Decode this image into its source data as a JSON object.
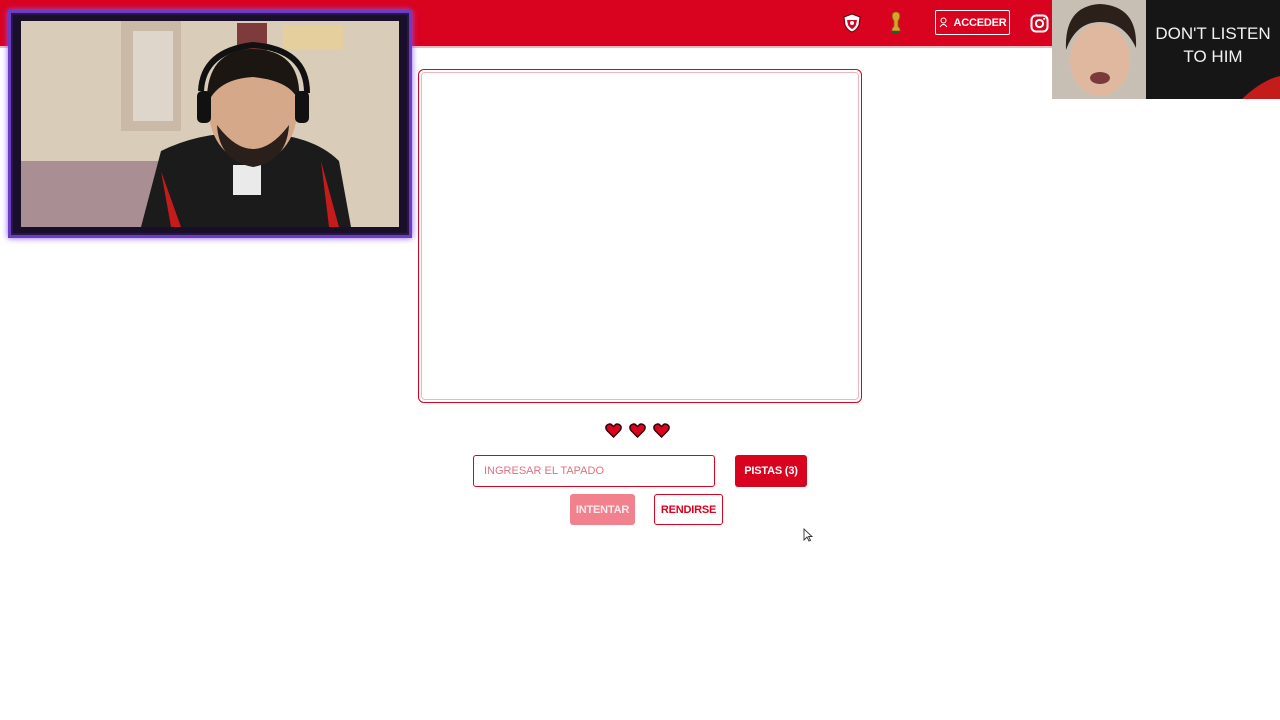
{
  "nav": {
    "login_label": "ACCEDER",
    "icons": [
      "shield-icon",
      "trophy-icon",
      "user-icon",
      "instagram-icon"
    ],
    "brand_color": "#d9021f"
  },
  "overlay": {
    "reaction_caption": "DON'T LISTEN\nTO HIM"
  },
  "game": {
    "lives": 3,
    "input_placeholder": "INGRESAR EL TAPADO",
    "hints_label": "PISTAS (3)",
    "try_label": "INTENTAR",
    "giveup_label": "RENDIRSE"
  }
}
